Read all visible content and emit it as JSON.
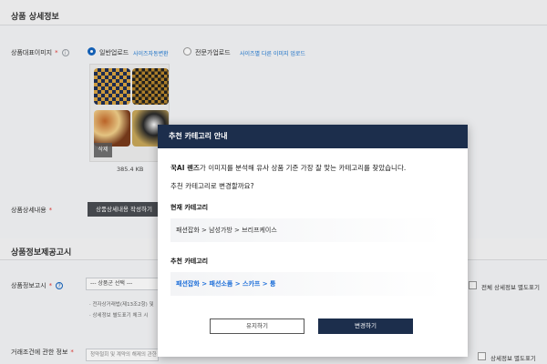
{
  "sections": {
    "detail_title": "상품 상세정보",
    "notice_title": "상품정보제공고시"
  },
  "image_field": {
    "label": "상품대표이미지",
    "option_general": "일반업로드",
    "option_general_link": "사이즈자동변환",
    "option_pro": "전문가업로드",
    "option_pro_link": "사이즈별 다른 이미지 업로드",
    "delete_label": "삭제",
    "file_size": "385.4 KB"
  },
  "detail_content": {
    "label": "상품상세내용",
    "button": "상품상세내용 작성하기"
  },
  "notice_field": {
    "label": "상품정보고시",
    "select_value": "--- 상품군 선택 ---",
    "note1": "· 전자상거래법(제13조2항) 및",
    "note2": "· 상세정보 별도표기 체크 시",
    "checkbox": "전체 상세정보 별도표기"
  },
  "trade_field": {
    "label": "거래조건에 관한 정보",
    "input_value": "청약철회 및 계약의 해제의 관한",
    "checkbox": "상세정보 별도표기"
  },
  "modal": {
    "title": "추천 카테고리 안내",
    "message_bold": "꾹AI 렌즈",
    "message_rest": "가 이미지를 분석해 유사 상품 기준 가장 잘 맞는 카테고리를 찾았습니다.",
    "question": "추천 카테고리로 변경할까요?",
    "current_label": "현재 카테고리",
    "current_value": "패션잡화 > 남성가방 > 브리프케이스",
    "recommended_label": "추천 카테고리",
    "recommended_value": "패션잡화 > 패션소품 > 스카프 > 퉁",
    "keep_button": "유지하기",
    "change_button": "변경하기"
  }
}
